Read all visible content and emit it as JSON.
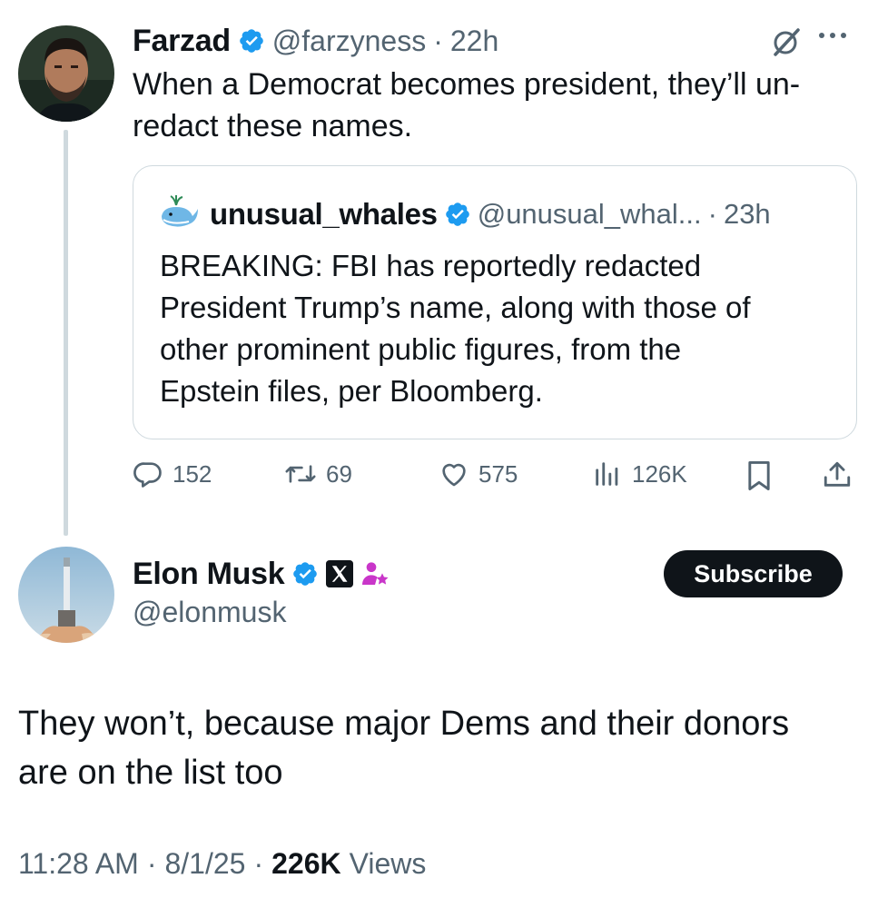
{
  "parent_tweet": {
    "author_name": "Farzad",
    "author_handle": "@farzyness",
    "separator": "·",
    "time": "22h",
    "text": "When a Democrat becomes president, they’ll un-redact these names.",
    "text_line1": "When a Democrat becomes president, they’ll un-",
    "text_line2": "redact these names.",
    "verified": true
  },
  "quoted_tweet": {
    "author_name": "unusual_whales",
    "author_handle": "@unusual_whal...",
    "separator": "·",
    "time": "23h",
    "verified": true,
    "text": "BREAKING: FBI has reportedly redacted President Trump’s name, along with those of other prominent public figures, from the Epstein files, per Bloomberg.",
    "lines": [
      "BREAKING: FBI has reportedly redacted",
      "President Trump’s name, along with those of",
      "other prominent public figures, from the",
      "Epstein files, per Bloomberg."
    ]
  },
  "actions": {
    "replies": "152",
    "reposts": "69",
    "likes": "575",
    "views": "126K"
  },
  "main_tweet": {
    "author_name": "Elon Musk",
    "author_handle": "@elonmusk",
    "subscribe_label": "Subscribe",
    "text": "They won’t, because major Dems and their donors are on the list too",
    "text_line1": "They won’t, because major Dems and their donors",
    "text_line2": "are on the list too",
    "timestamp_time": "11:28 AM",
    "timestamp_date": "8/1/25",
    "separator": "·",
    "views_count": "226K",
    "views_label": "Views"
  },
  "colors": {
    "verified_blue": "#1d9bf0",
    "text_primary": "#0f1419",
    "text_secondary": "#536471",
    "border": "#cfd9de",
    "affiliate_pink": "#c936c9"
  },
  "icons": [
    "verified-badge-icon",
    "grok-slash-icon",
    "more-icon",
    "reply-icon",
    "repost-icon",
    "like-icon",
    "views-icon",
    "bookmark-icon",
    "share-icon",
    "x-logo-icon",
    "affiliate-icon",
    "whale-icon"
  ]
}
